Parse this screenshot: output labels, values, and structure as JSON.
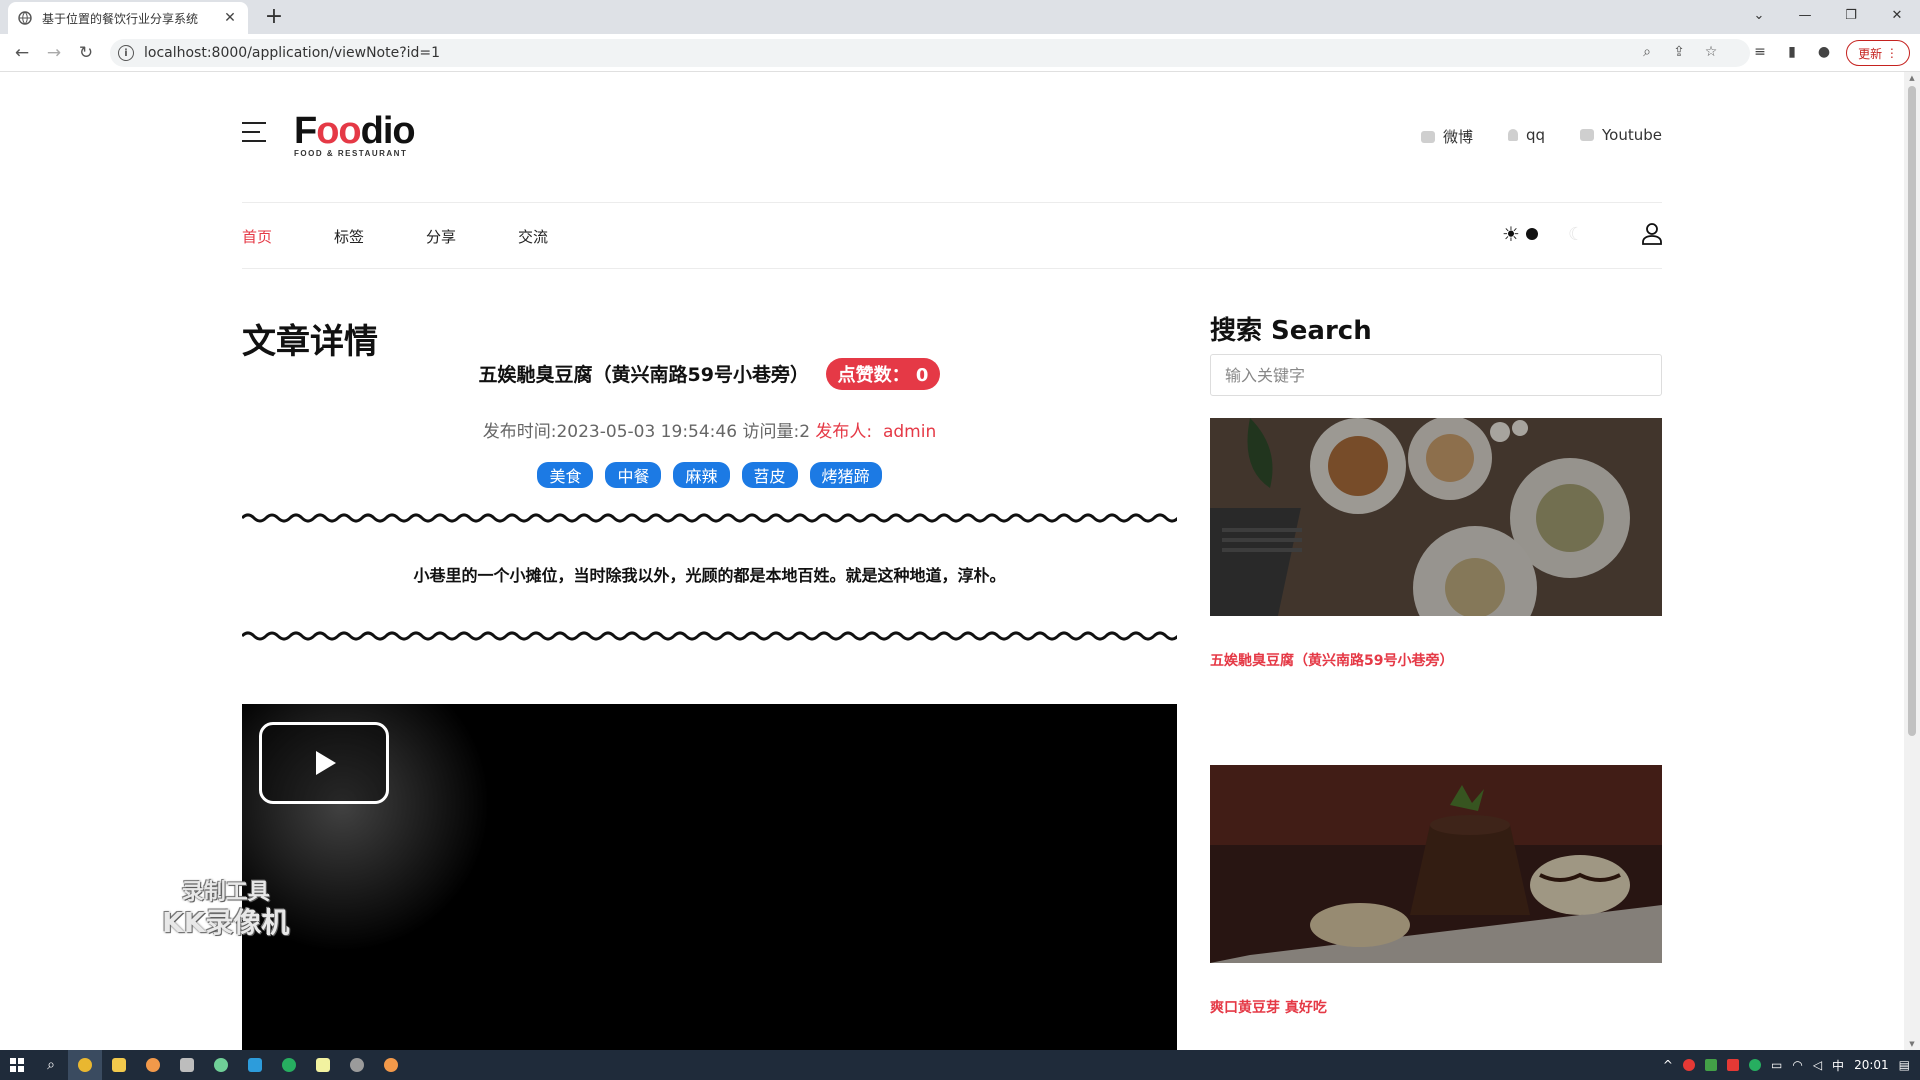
{
  "browser": {
    "tab_title": "基于位置的餐饮行业分享系统",
    "url": "localhost:8000/application/viewNote?id=1",
    "update_label": "更新"
  },
  "header": {
    "logo_text_1": "F",
    "logo_text_2": "oo",
    "logo_text_3": "dio",
    "logo_sub": "FOOD & RESTAURANT",
    "social": [
      {
        "label": "微博",
        "icon": "weibo-icon"
      },
      {
        "label": "qq",
        "icon": "qq-icon"
      },
      {
        "label": "Youtube",
        "icon": "youtube-icon"
      }
    ]
  },
  "nav": {
    "items": [
      "首页",
      "标签",
      "分享",
      "交流"
    ],
    "active_index": 0
  },
  "article": {
    "section_title": "文章详情",
    "title": "五娭馳臭豆腐（黄兴南路59号小巷旁）",
    "likes_label": "点赞数：",
    "likes_count": "0",
    "publish_label": "发布时间:",
    "publish_time": "2023-05-03 19:54:46",
    "views_label": "访问量:",
    "views_count": "2",
    "author_label": "发布人:",
    "author": "admin",
    "tags": [
      "美食",
      "中餐",
      "麻辣",
      "苕皮",
      "烤猪蹄"
    ],
    "content": "小巷里的一个小摊位，当时除我以外，光顾的都是本地百姓。就是这种地道，淳朴。"
  },
  "watermark": {
    "line1": "录制工具",
    "line2": "KK录像机"
  },
  "sidebar": {
    "search_title": "搜索 Search",
    "search_placeholder": "输入关键字",
    "cards": [
      {
        "title": "五娭馳臭豆腐（黄兴南路59号小巷旁）"
      },
      {
        "title": "爽口黄豆芽 真好吃"
      }
    ]
  },
  "taskbar": {
    "time": "20:01",
    "ime": "中"
  },
  "colors": {
    "accent": "#e53946",
    "tag_blue": "#1c7ae4",
    "taskbar": "#1f2b3a"
  }
}
